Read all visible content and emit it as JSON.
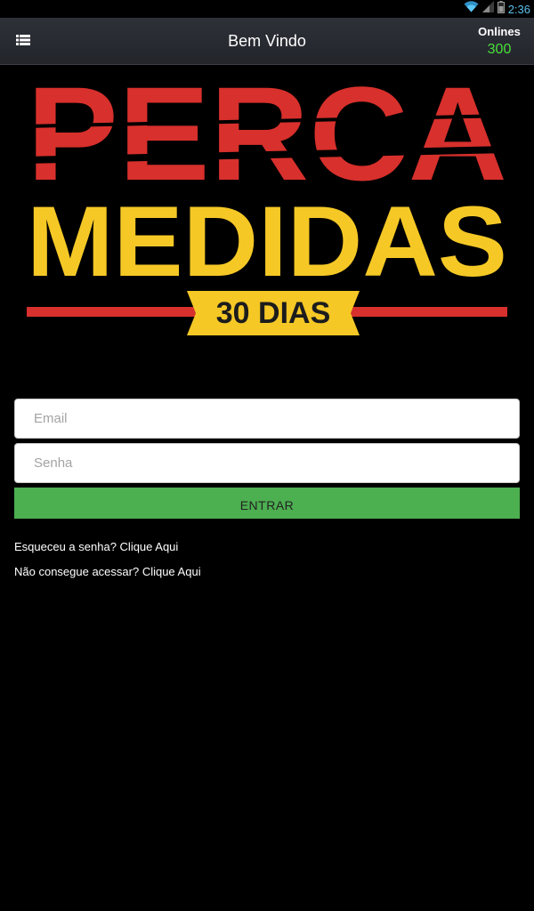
{
  "status_bar": {
    "time": "2:36",
    "icons": [
      "wifi-icon",
      "cellular-signal-icon",
      "battery-icon"
    ]
  },
  "header": {
    "menu_icon": "list-menu-icon",
    "title": "Bem Vindo",
    "online_label": "Onlines",
    "online_count": "300",
    "online_count_color": "#49e03b"
  },
  "logo": {
    "line1": "PERCA",
    "line2": "MEDIDAS",
    "badge": "30 DIAS",
    "colors": {
      "red": "#d8302c",
      "yellow": "#f5c826",
      "dark": "#1c1c1c"
    }
  },
  "form": {
    "email_placeholder": "Email",
    "senha_placeholder": "Senha",
    "submit_label": "ENTRAR",
    "submit_color": "#4caf50"
  },
  "links": {
    "forgot": "Esqueceu a senha? Clique Aqui",
    "cant_access": "Não consegue acessar? Clique Aqui"
  }
}
